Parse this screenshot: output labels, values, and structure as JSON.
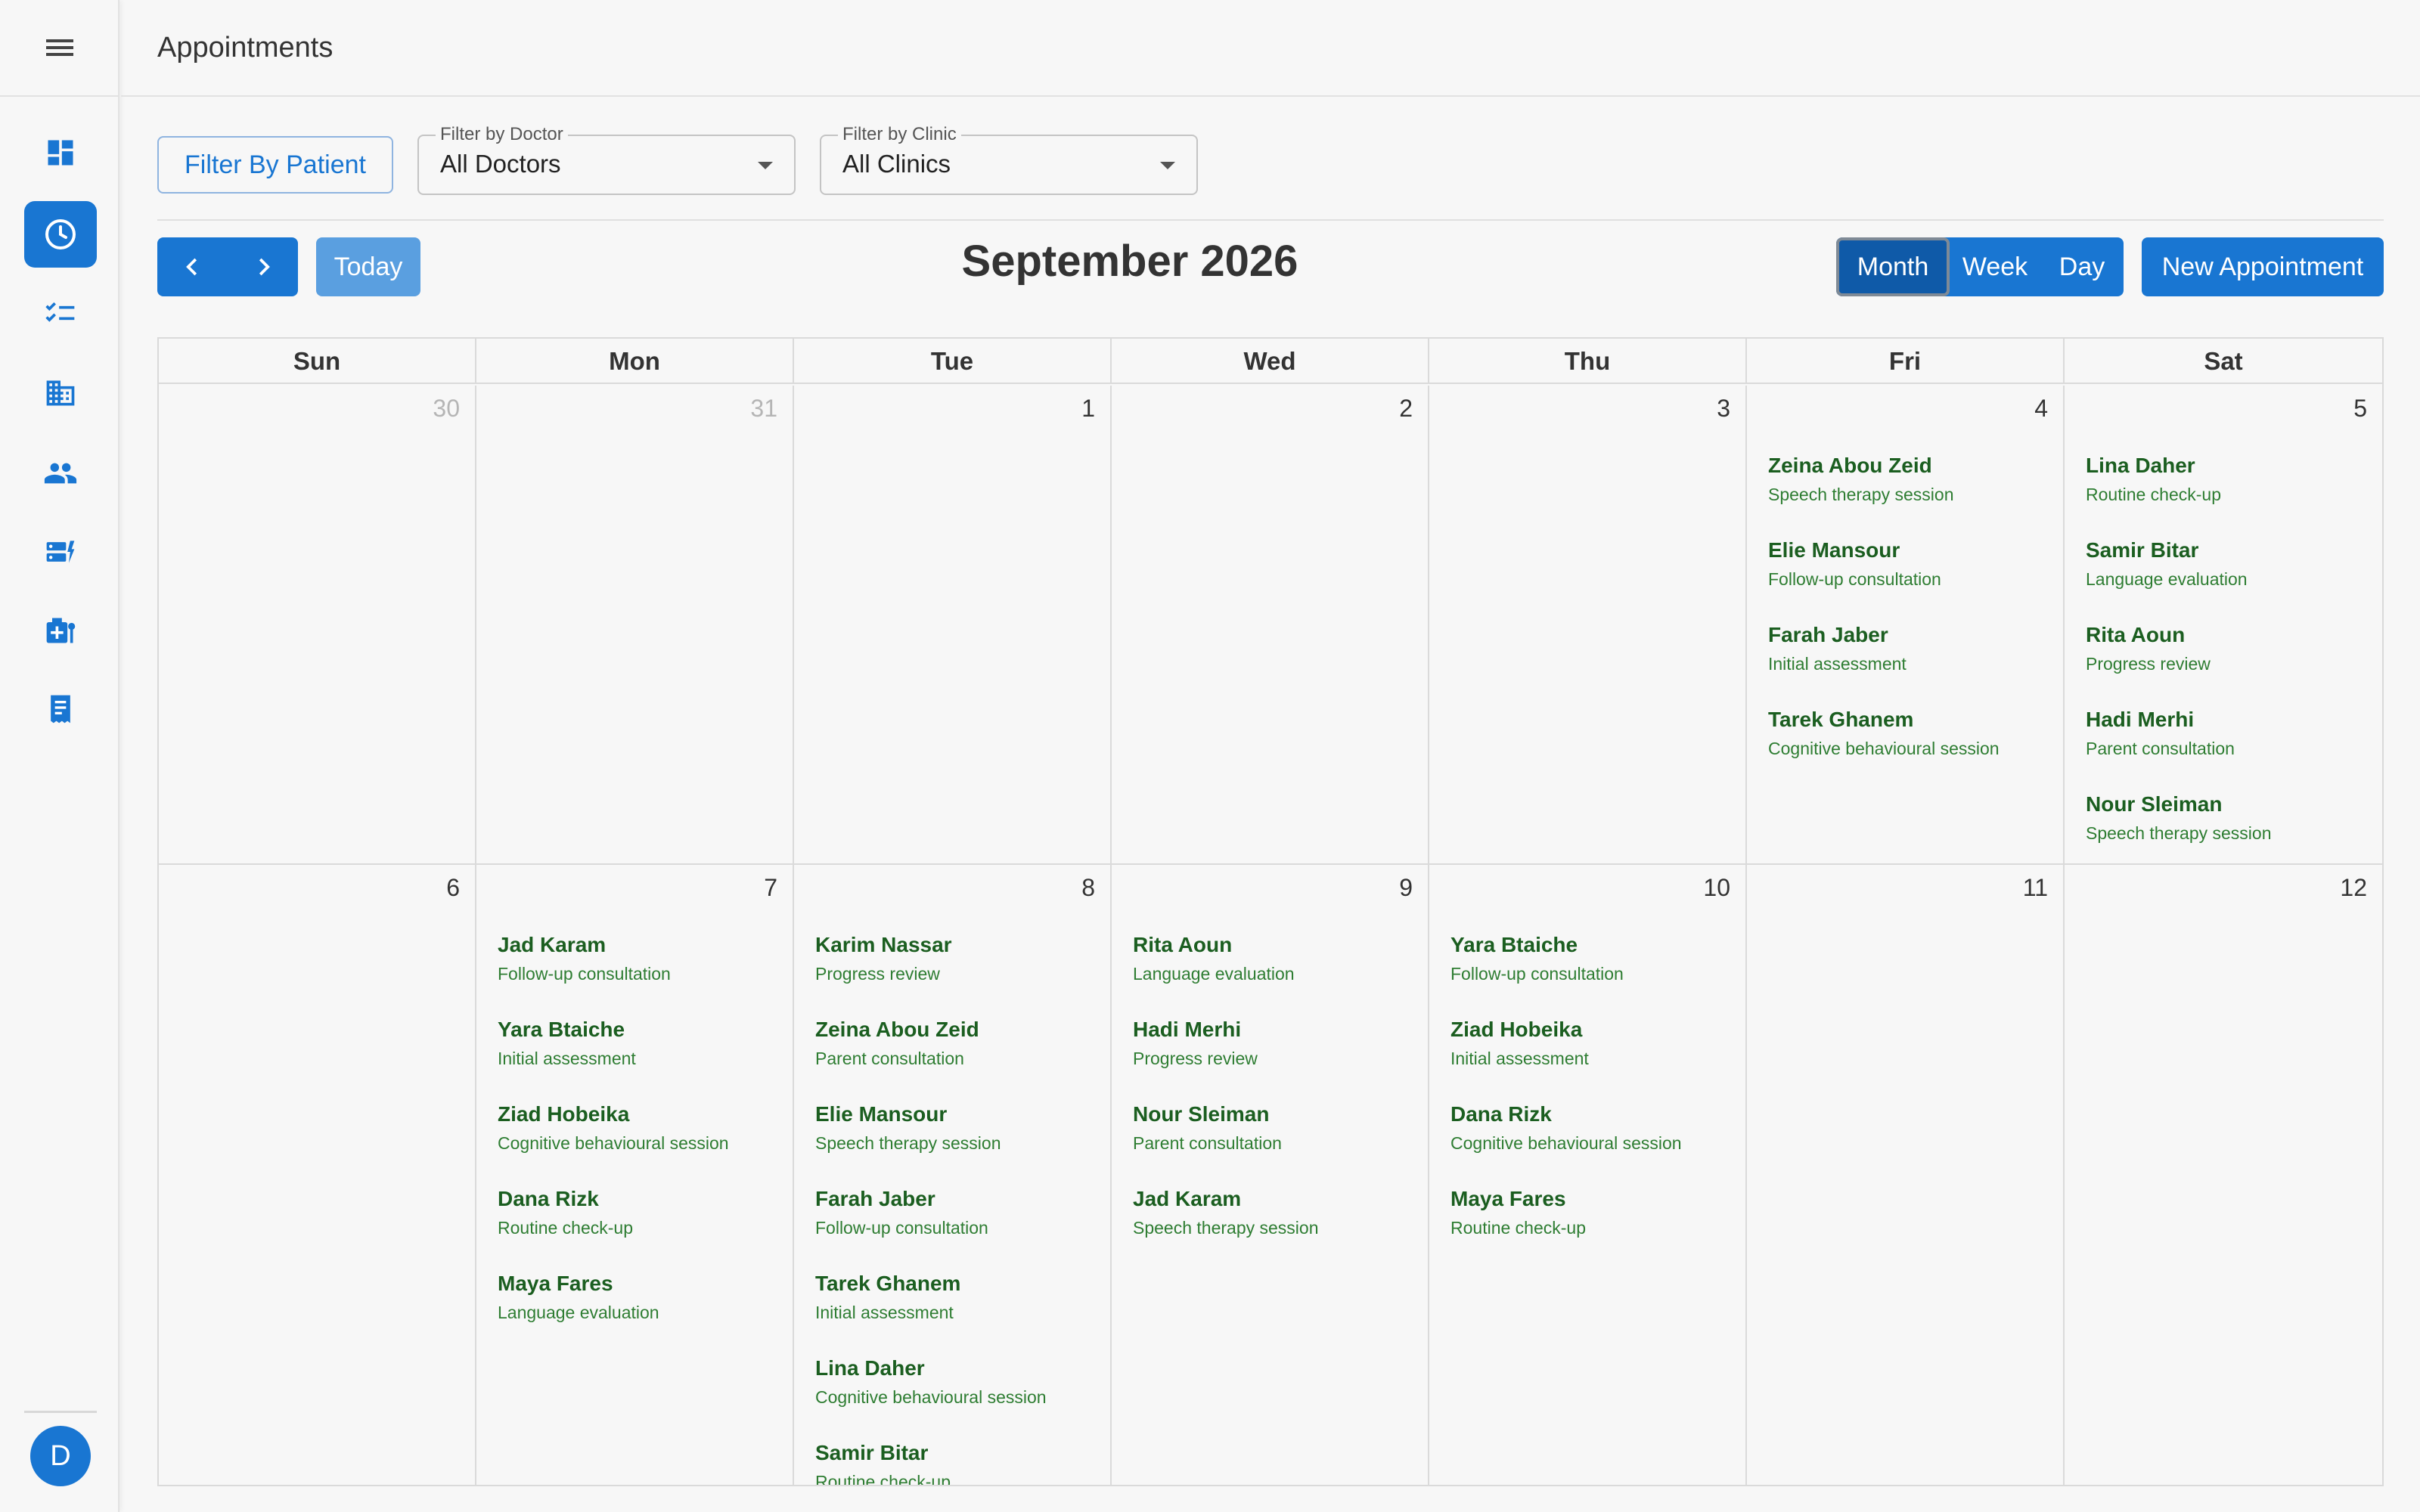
{
  "header": {
    "title": "Appointments"
  },
  "sidebar": {
    "items": [
      {
        "icon": "dashboard-icon"
      },
      {
        "icon": "clock-icon",
        "active": true
      },
      {
        "icon": "checklist-icon"
      },
      {
        "icon": "building-icon"
      },
      {
        "icon": "people-icon"
      },
      {
        "icon": "badge-icon"
      },
      {
        "icon": "medical-kit-icon"
      },
      {
        "icon": "receipt-icon"
      }
    ],
    "avatar": "D"
  },
  "filters": {
    "patient_button": "Filter By Patient",
    "doctor": {
      "label": "Filter by Doctor",
      "value": "All Doctors"
    },
    "clinic": {
      "label": "Filter by Clinic",
      "value": "All Clinics"
    }
  },
  "toolbar": {
    "today": "Today",
    "title": "September 2026",
    "views": [
      "Month",
      "Week",
      "Day"
    ],
    "active_view": "Month",
    "new_button": "New Appointment"
  },
  "calendar": {
    "weekdays": [
      "Sun",
      "Mon",
      "Tue",
      "Wed",
      "Thu",
      "Fri",
      "Sat"
    ],
    "weeks": [
      [
        {
          "day": "30",
          "other": true,
          "events": []
        },
        {
          "day": "31",
          "other": true,
          "events": []
        },
        {
          "day": "1",
          "events": []
        },
        {
          "day": "2",
          "events": []
        },
        {
          "day": "3",
          "events": []
        },
        {
          "day": "4",
          "events": [
            {
              "name": "Zeina Abou Zeid",
              "type": "Speech therapy session"
            },
            {
              "name": "Elie Mansour",
              "type": "Follow-up consultation"
            },
            {
              "name": "Farah Jaber",
              "type": "Initial assessment"
            },
            {
              "name": "Tarek Ghanem",
              "type": "Cognitive behavioural session"
            }
          ]
        },
        {
          "day": "5",
          "events": [
            {
              "name": "Lina Daher",
              "type": "Routine check-up"
            },
            {
              "name": "Samir Bitar",
              "type": "Language evaluation"
            },
            {
              "name": "Rita Aoun",
              "type": "Progress review"
            },
            {
              "name": "Hadi Merhi",
              "type": "Parent consultation"
            },
            {
              "name": "Nour Sleiman",
              "type": "Speech therapy session"
            }
          ]
        }
      ],
      [
        {
          "day": "6",
          "events": []
        },
        {
          "day": "7",
          "events": [
            {
              "name": "Jad Karam",
              "type": "Follow-up consultation"
            },
            {
              "name": "Yara Btaiche",
              "type": "Initial assessment"
            },
            {
              "name": "Ziad Hobeika",
              "type": "Cognitive behavioural session"
            },
            {
              "name": "Dana Rizk",
              "type": "Routine check-up"
            },
            {
              "name": "Maya Fares",
              "type": "Language evaluation"
            }
          ]
        },
        {
          "day": "8",
          "events": [
            {
              "name": "Karim Nassar",
              "type": "Progress review"
            },
            {
              "name": "Zeina Abou Zeid",
              "type": "Parent consultation"
            },
            {
              "name": "Elie Mansour",
              "type": "Speech therapy session"
            },
            {
              "name": "Farah Jaber",
              "type": "Follow-up consultation"
            },
            {
              "name": "Tarek Ghanem",
              "type": "Initial assessment"
            },
            {
              "name": "Lina Daher",
              "type": "Cognitive behavioural session"
            },
            {
              "name": "Samir Bitar",
              "type": "Routine check-up"
            }
          ]
        },
        {
          "day": "9",
          "events": [
            {
              "name": "Rita Aoun",
              "type": "Language evaluation"
            },
            {
              "name": "Hadi Merhi",
              "type": "Progress review"
            },
            {
              "name": "Nour Sleiman",
              "type": "Parent consultation"
            },
            {
              "name": "Jad Karam",
              "type": "Speech therapy session"
            }
          ]
        },
        {
          "day": "10",
          "events": [
            {
              "name": "Yara Btaiche",
              "type": "Follow-up consultation"
            },
            {
              "name": "Ziad Hobeika",
              "type": "Initial assessment"
            },
            {
              "name": "Dana Rizk",
              "type": "Cognitive behavioural session"
            },
            {
              "name": "Maya Fares",
              "type": "Routine check-up"
            }
          ]
        },
        {
          "day": "11",
          "events": []
        },
        {
          "day": "12",
          "events": []
        }
      ]
    ]
  },
  "colors": {
    "primary": "#1976d2",
    "event_text": "#1b5e20"
  }
}
